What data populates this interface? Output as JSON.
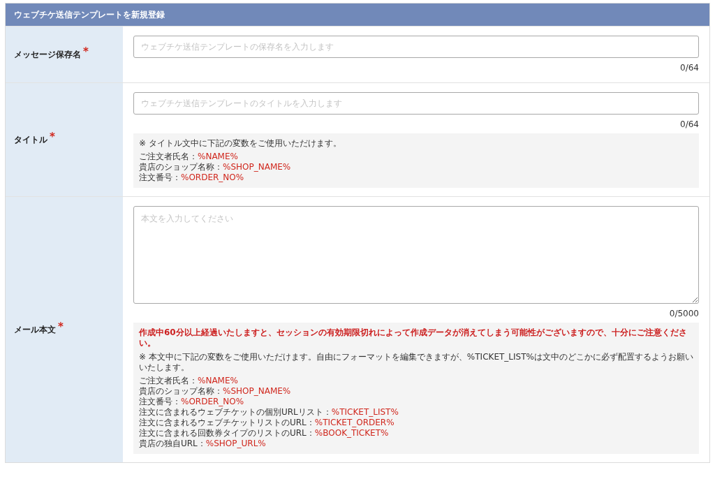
{
  "header": {
    "title": "ウェブチケ送信テンプレートを新規登録"
  },
  "fields": [
    {
      "label": "メッセージ保存名",
      "required_mark": "*",
      "kind": "input",
      "placeholder": "ウェブチケ送信テンプレートの保存名を入力します",
      "counter": "0/64"
    },
    {
      "label": "タイトル",
      "required_mark": "*",
      "kind": "input",
      "placeholder": "ウェブチケ送信テンプレートのタイトルを入力します",
      "counter": "0/64",
      "note": {
        "intro": "※ タイトル文中に下記の変数をご使用いただけます。",
        "variables": [
          {
            "label": "ご注文者氏名：",
            "value": "%NAME%"
          },
          {
            "label": "貴店のショップ名称：",
            "value": "%SHOP_NAME%"
          },
          {
            "label": "注文番号：",
            "value": "%ORDER_NO%"
          }
        ]
      }
    },
    {
      "label": "メール本文",
      "required_mark": "*",
      "kind": "textarea",
      "placeholder": "本文を入力してください",
      "counter": "0/5000",
      "note": {
        "warning": "作成中60分以上経過いたしますと、セッションの有効期限切れによって作成データが消えてしまう可能性がございますので、十分にご注意ください。",
        "intro": "※ 本文中に下記の変数をご使用いただけます。自由にフォーマットを編集できますが、%TICKET_LIST%は文中のどこかに必ず配置するようお願いいたします。",
        "variables": [
          {
            "label": "ご注文者氏名：",
            "value": "%NAME%"
          },
          {
            "label": "貴店のショップ名称：",
            "value": "%SHOP_NAME%"
          },
          {
            "label": "注文番号：",
            "value": "%ORDER_NO%"
          },
          {
            "label": "注文に含まれるウェブチケットの個別URLリスト：",
            "value": "%TICKET_LIST%"
          },
          {
            "label": "注文に含まれるウェブチケットリストのURL：",
            "value": "%TICKET_ORDER%"
          },
          {
            "label": "注文に含まれる回数券タイプのリストのURL：",
            "value": "%BOOK_TICKET%"
          },
          {
            "label": "貴店の独自URL：",
            "value": "%SHOP_URL%"
          }
        ]
      }
    }
  ]
}
